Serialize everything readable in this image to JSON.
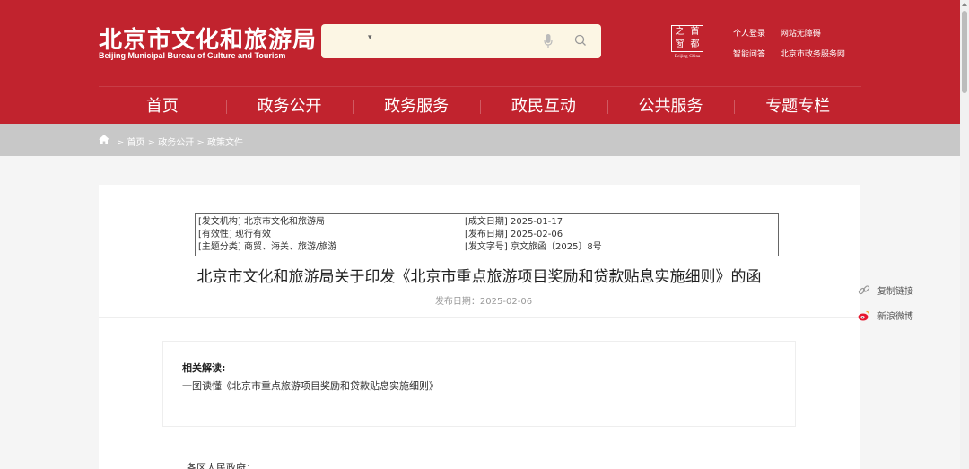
{
  "header": {
    "logo_cn": "北京市文化和旅游局",
    "logo_en": "Beijing Municipal Bureau of Culture and Tourism",
    "search": {
      "dropdown": "▾",
      "placeholder": ""
    },
    "seal": {
      "chars": [
        "之",
        "首",
        "窗",
        "都"
      ],
      "caption": "Beijing-China"
    },
    "links_row1": [
      "个人登录",
      "网站无障碍"
    ],
    "links_row2": [
      "智能问答",
      "北京市政务服务网"
    ],
    "brand_color": "#c1232e"
  },
  "nav": [
    "首页",
    "政务公开",
    "政务服务",
    "政民互动",
    "公共服务",
    "专题专栏"
  ],
  "breadcrumb": "> 首页 > 政务公开 > 政策文件",
  "meta": {
    "agency": "[发文机构] 北京市文化和旅游局",
    "validity": "[有效性] 现行有效",
    "category": "[主题分类] 商贸、海关、旅游/旅游",
    "created": "[成文日期] 2025-01-17",
    "published": "[发布日期] 2025-02-06",
    "doc_no": "[发文字号] 京文旅函〔2025〕8号"
  },
  "article": {
    "title": "北京市文化和旅游局关于印发《北京市重点旅游项目奖励和贷款贴息实施细则》的函",
    "pubdate": "发布日期：2025-02-06",
    "related_label": "相关解读:",
    "related_link": "一图读懂《北京市重点旅游项目奖励和贷款贴息实施细则》",
    "addressee": "各区人民政府："
  },
  "share": {
    "copy_link": "复制链接",
    "weibo": "新浪微博"
  }
}
